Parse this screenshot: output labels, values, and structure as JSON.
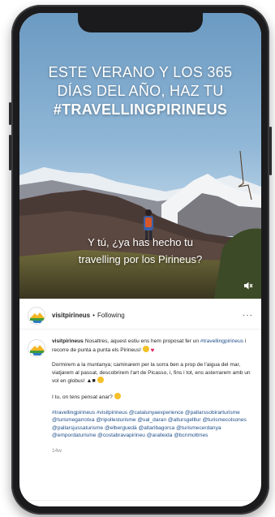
{
  "video": {
    "headline": {
      "line1": "ESTE VERANO Y LOS 365",
      "line2": "DÍAS DEL AÑO, HAZ TU",
      "hashtag": "#TRAVELLINGPIRINEUS"
    },
    "overlay_line1": "Y tú, ¿ya has hecho tu",
    "overlay_line2": "travelling por los Pirineus?",
    "mute_icon": "speaker-muted-icon"
  },
  "post": {
    "username": "visitpirineus",
    "separator": "•",
    "follow_status": "Following",
    "more_icon": "more-options-icon",
    "more_glyph": "···"
  },
  "caption": {
    "username": "visitpirineus",
    "p1_text": "Nosaltres, aquest estiu ens hem proposat fer un",
    "p1_tag": "#travellingpirineus",
    "p1_tail": "i recorre de punta a punta els Pirineus!",
    "p2_text": "Dormirem a la muntanya; caminarem per la sorra ben a prop de l'aigua del mar, viatjarem al passat, descobrirem l'art de Picasso, i, fins i tot, ens asterrarem amb un vol en globus!",
    "p3_text": "I tu, on tens pensat anar?",
    "hashtags": "#travellingpirineus #visitpirineus @catalunyaexperience @pallarssobirarturisme @turismegarrotxa @ripollesturisme @val_daran @altursgelltur @turismecolsones @pallarsjussaturisme @elberguedà @altaribagorca @turismecerdanya @empordaturisme @costabravapirineu @aralleida @bcnmoltmes",
    "time": "14w"
  },
  "colors": {
    "link": "#1f4f8a",
    "text": "#262626",
    "muted": "#8e8e8e",
    "phone": "#1b1b1d"
  }
}
